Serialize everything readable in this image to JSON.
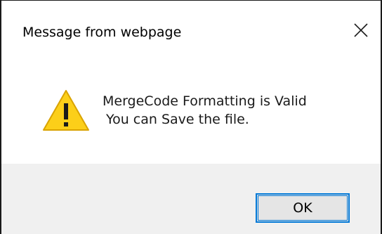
{
  "dialog": {
    "title": "Message from webpage",
    "close_icon": "close-icon",
    "message_line1": "MergeCode Formatting is Valid",
    "message_line2": "You can Save the file.",
    "icon": "warning-icon",
    "ok_label": "OK",
    "colors": {
      "warning_fill": "#fccf19",
      "warning_stroke": "#d9a300",
      "button_border": "#0078d7",
      "footer_bg": "#f0f0f0"
    }
  }
}
